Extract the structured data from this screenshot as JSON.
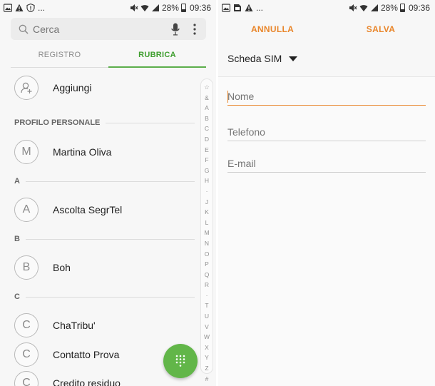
{
  "left_status": {
    "battery": "28%",
    "time": "09:36",
    "more": "..."
  },
  "right_status": {
    "battery": "28%",
    "time": "09:36",
    "more": "..."
  },
  "search": {
    "placeholder": "Cerca"
  },
  "tabs": [
    {
      "label": "REGISTRO",
      "active": false
    },
    {
      "label": "RUBRICA",
      "active": true
    }
  ],
  "contacts": {
    "add_label": "Aggiungi",
    "profile_header": "PROFILO PERSONALE",
    "profile": {
      "initial": "M",
      "name": "Martina Oliva"
    },
    "sections": [
      {
        "letter": "A",
        "entries": [
          {
            "initial": "A",
            "name": "Ascolta SegrTel"
          }
        ]
      },
      {
        "letter": "B",
        "entries": [
          {
            "initial": "B",
            "name": "Boh"
          }
        ]
      },
      {
        "letter": "C",
        "entries": [
          {
            "initial": "C",
            "name": "ChaTribu'"
          },
          {
            "initial": "C",
            "name": "Contatto Prova"
          },
          {
            "initial": "C",
            "name": "Credito residuo"
          }
        ]
      }
    ]
  },
  "alpha_index": [
    "☆",
    "&",
    "A",
    "B",
    "C",
    "D",
    "E",
    "F",
    "G",
    "H",
    "·",
    "J",
    "K",
    "L",
    "M",
    "N",
    "O",
    "P",
    "Q",
    "R",
    "·",
    "T",
    "U",
    "V",
    "W",
    "X",
    "Y",
    "Z",
    "#"
  ],
  "editor": {
    "cancel_label": "ANNULLA",
    "save_label": "SALVA",
    "storage": "Scheda SIM",
    "fields": {
      "name_placeholder": "Nome",
      "phone_placeholder": "Telefono",
      "email_placeholder": "E-mail"
    }
  },
  "colors": {
    "accent_green": "#5cae4b",
    "fab_green": "#62b649",
    "accent_orange": "#e9862b"
  },
  "icons": {
    "search": "search-icon",
    "mic": "mic-icon",
    "more": "more-vert-icon",
    "add_contact": "add-person-icon",
    "dialpad": "dialpad-icon",
    "dropdown": "triangle-down-icon"
  }
}
